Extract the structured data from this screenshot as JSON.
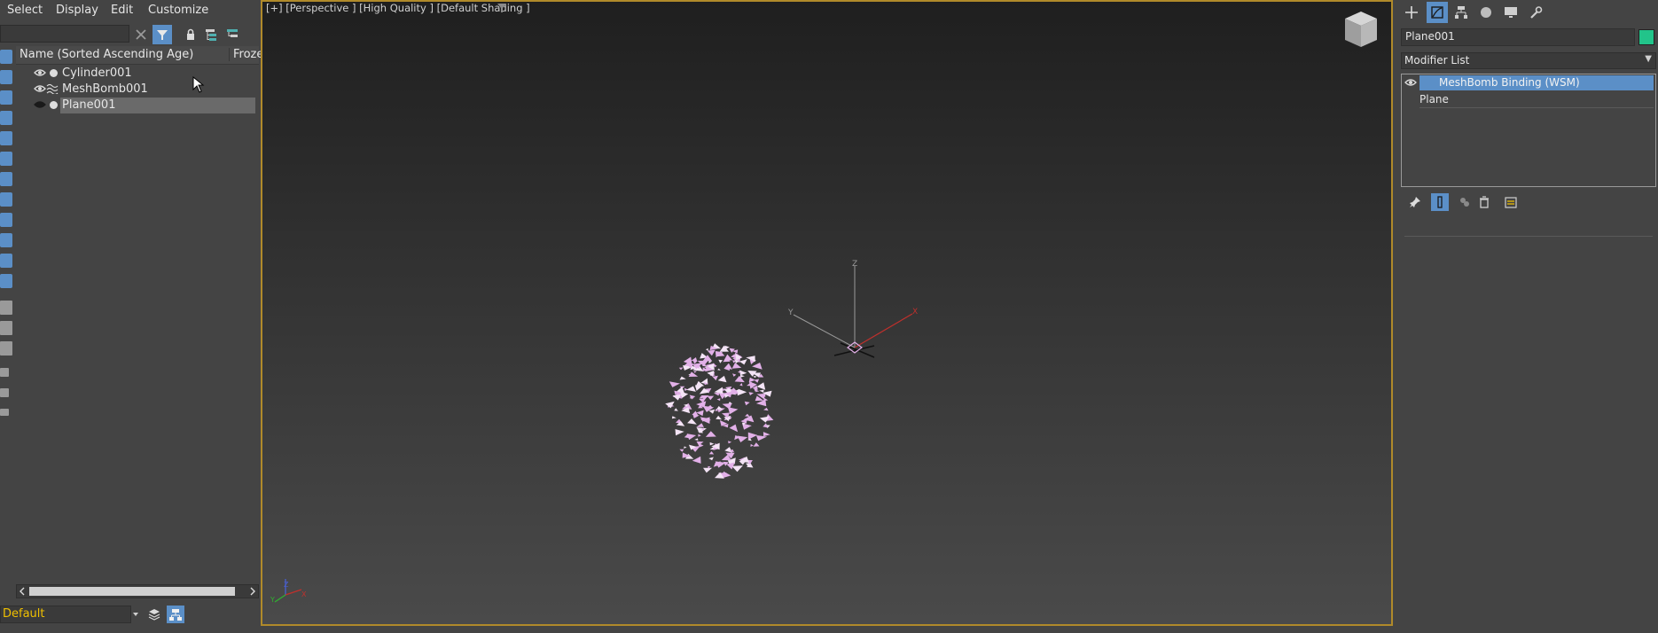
{
  "menubar": {
    "items": [
      "Select",
      "Display",
      "Edit",
      "Customize"
    ]
  },
  "explorer": {
    "search_placeholder": "",
    "columns": {
      "name": "Name (Sorted Ascending Age)",
      "frozen": "Froze"
    },
    "rows": [
      {
        "name": "Cylinder001",
        "icon": "dot-icon",
        "selected": false
      },
      {
        "name": "MeshBomb001",
        "icon": "wave-icon",
        "selected": false
      },
      {
        "name": "Plane001",
        "icon": "dot-icon",
        "selected": true
      }
    ],
    "layer": "Default"
  },
  "viewport": {
    "label": "[+] [Perspective ] [High Quality ] [Default Shading ]",
    "axes": {
      "x": "X",
      "y": "Y",
      "z": "Z"
    }
  },
  "command_panel": {
    "object_name": "Plane001",
    "object_color": "#22c48a",
    "modifier_list": "Modifier List",
    "stack": [
      {
        "label": "MeshBomb Binding (WSM)",
        "selected": true
      },
      {
        "label": "Plane",
        "selected": false
      }
    ]
  },
  "colors": {
    "accent": "#5b8fc7",
    "viewport_border": "#b08a2a",
    "layer_text": "#f0c000",
    "fragments": "#e2b0e8"
  }
}
